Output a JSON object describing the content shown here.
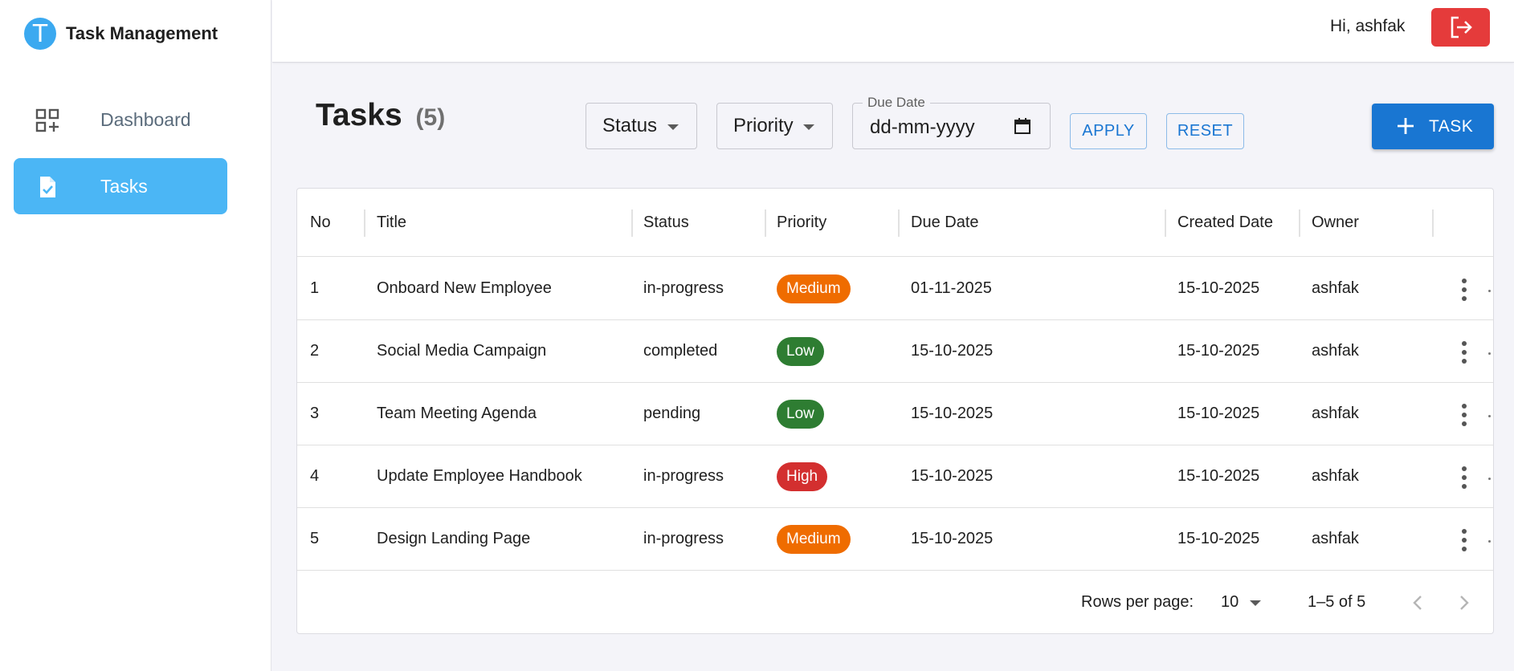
{
  "brand": {
    "logo_letter": "T",
    "name": "Task Management"
  },
  "sidebar": {
    "items": [
      {
        "label": "Dashboard",
        "icon": "dashboard-grid-icon",
        "active": false
      },
      {
        "label": "Tasks",
        "icon": "task-document-icon",
        "active": true
      }
    ]
  },
  "header": {
    "greeting": "Hi, ashfak",
    "logout_icon": "logout-icon"
  },
  "toolbar": {
    "title": "Tasks",
    "count": "(5)",
    "status_filter": "Status",
    "priority_filter": "Priority",
    "due_date_label": "Due Date",
    "due_date_placeholder": "dd-mm-yyyy",
    "apply_label": "APPLY",
    "reset_label": "RESET",
    "add_task_label": "TASK"
  },
  "table": {
    "columns": [
      "No",
      "Title",
      "Status",
      "Priority",
      "Due Date",
      "Created Date",
      "Owner"
    ],
    "rows": [
      {
        "no": "1",
        "title": "Onboard New Employee",
        "status": "in-progress",
        "priority": "Medium",
        "due_date": "01-11-2025",
        "created_date": "15-10-2025",
        "owner": "ashfak"
      },
      {
        "no": "2",
        "title": "Social Media Campaign",
        "status": "completed",
        "priority": "Low",
        "due_date": "15-10-2025",
        "created_date": "15-10-2025",
        "owner": "ashfak"
      },
      {
        "no": "3",
        "title": "Team Meeting Agenda",
        "status": "pending",
        "priority": "Low",
        "due_date": "15-10-2025",
        "created_date": "15-10-2025",
        "owner": "ashfak"
      },
      {
        "no": "4",
        "title": "Update Employee Handbook",
        "status": "in-progress",
        "priority": "High",
        "due_date": "15-10-2025",
        "created_date": "15-10-2025",
        "owner": "ashfak"
      },
      {
        "no": "5",
        "title": "Design Landing Page",
        "status": "in-progress",
        "priority": "Medium",
        "due_date": "15-10-2025",
        "created_date": "15-10-2025",
        "owner": "ashfak"
      }
    ]
  },
  "pagination": {
    "rows_per_page_label": "Rows per page:",
    "rows_per_page": "10",
    "range": "1–5 of 5"
  },
  "colors": {
    "sidebar_active": "#4bb6f5",
    "primary": "#1976d2",
    "logout": "#e53b3b",
    "priority_medium": "#ef6c00",
    "priority_low": "#2e7d32",
    "priority_high": "#d32f2f"
  }
}
